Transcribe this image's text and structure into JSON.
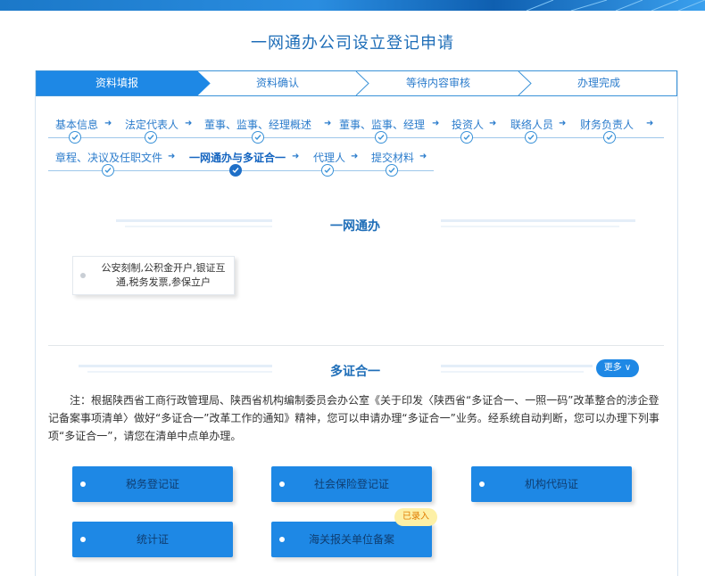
{
  "page": {
    "title": "一网通办公司设立登记申请"
  },
  "steps": [
    {
      "label": "资料填报",
      "active": true
    },
    {
      "label": "资料确认",
      "active": false
    },
    {
      "label": "等待内容审核",
      "active": false
    },
    {
      "label": "办理完成",
      "active": false
    }
  ],
  "substeps_row1": [
    "基本信息",
    "法定代表人",
    "董事、监事、经理概述",
    "董事、监事、经理",
    "投资人",
    "联络人员",
    "财务负责人"
  ],
  "substeps_row2": [
    "章程、决议及任职文件",
    "一网通办与多证合一",
    "代理人",
    "提交材料"
  ],
  "yiwang": {
    "title": "一网通办",
    "card_text": "公安刻制,公积金开户,银证互通,税务发票,参保立户"
  },
  "duozheng": {
    "title": "多证合一",
    "more_label": "更多 ∨",
    "note": "注：根据陕西省工商行政管理局、陕西省机构编制委员会办公室《关于印发〈陕西省“多证合一、一照一码”改革整合的涉企登记备案事项清单〉做好“多证合一”改革工作的通知》精神，您可以申请办理“多证合一”业务。经系统自动判断，您可以办理下列事项“多证合一”，请您在清单中点单办理。",
    "items": [
      "税务登记证",
      "社会保险登记证",
      "机构代码证",
      "统计证",
      "海关报关单位备案"
    ],
    "badge": "已录入"
  },
  "colors": {
    "primary": "#1e88e5",
    "accent": "#1f6eb8",
    "badge_bg": "#fdf0a6",
    "badge_text": "#e07b00"
  }
}
